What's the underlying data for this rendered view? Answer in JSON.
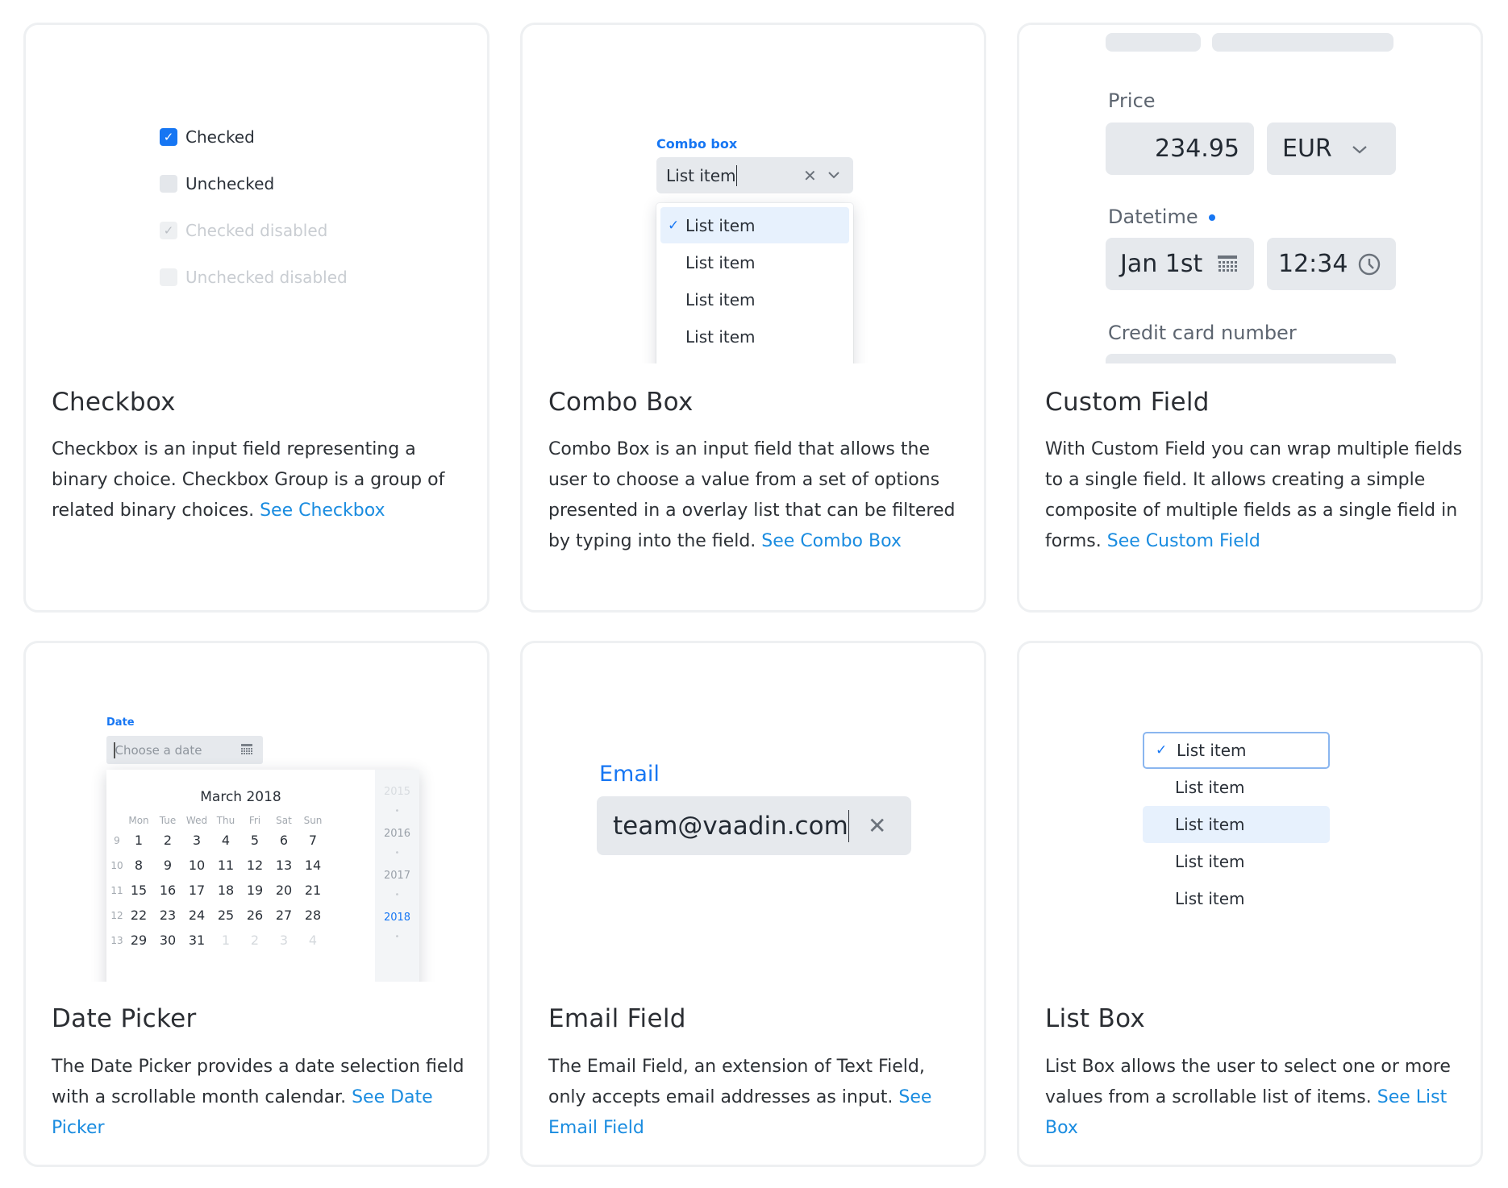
{
  "colors": {
    "accent": "#1676f3",
    "link": "#1a8ce0",
    "field_bg": "#e6e9ed",
    "selected_bg": "#e7f1fd"
  },
  "cards": {
    "checkbox": {
      "title": "Checkbox",
      "description": "Checkbox is an input field representing a binary choice. Checkbox Group is a group of related binary choices. ",
      "link": "See Checkbox",
      "preview": {
        "items": [
          {
            "label": "Checked",
            "checked": true,
            "disabled": false
          },
          {
            "label": "Unchecked",
            "checked": false,
            "disabled": false
          },
          {
            "label": "Checked disabled",
            "checked": true,
            "disabled": true
          },
          {
            "label": "Unchecked disabled",
            "checked": false,
            "disabled": true
          }
        ]
      }
    },
    "combo_box": {
      "title": "Combo Box",
      "description": "Combo Box is an input field that allows the user to choose a value from a set of options presented in a overlay list that can be filtered by typing into the field. ",
      "link": "See Combo Box",
      "preview": {
        "label": "Combo box",
        "value": "List item",
        "clear_icon": "close-icon",
        "toggle_icon": "chevron-down-icon",
        "items": [
          "List item",
          "List item",
          "List item",
          "List item"
        ],
        "selected_index": 0
      }
    },
    "custom_field": {
      "title": "Custom Field",
      "description": "With Custom Field you can wrap multiple fields to a single field. It allows creating a simple composite of multiple fields as a single field in forms. ",
      "link": "See Custom Field",
      "preview": {
        "price_label": "Price",
        "price_value": "234.95",
        "currency_value": "EUR",
        "datetime_label": "Datetime",
        "date_value": "Jan 1st",
        "time_value": "12:34",
        "credit_card_label": "Credit card number"
      }
    },
    "date_picker": {
      "title": "Date Picker",
      "description": "The Date Picker provides a date selection field with a scrollable month calendar. ",
      "link": "See Date Picker",
      "preview": {
        "label": "Date",
        "placeholder": "Choose a date",
        "month_title": "March 2018",
        "weekdays": [
          "Mon",
          "Tue",
          "Wed",
          "Thu",
          "Fri",
          "Sat",
          "Sun"
        ],
        "weeks": [
          {
            "number": "9",
            "days": [
              "1",
              "2",
              "3",
              "4",
              "5",
              "6",
              "7"
            ]
          },
          {
            "number": "10",
            "days": [
              "8",
              "9",
              "10",
              "11",
              "12",
              "13",
              "14"
            ]
          },
          {
            "number": "11",
            "days": [
              "15",
              "16",
              "17",
              "18",
              "19",
              "20",
              "21"
            ]
          },
          {
            "number": "12",
            "days": [
              "22",
              "23",
              "24",
              "25",
              "26",
              "27",
              "28"
            ]
          },
          {
            "number": "13",
            "days": [
              "29",
              "30",
              "31",
              "1",
              "2",
              "3",
              "4"
            ]
          }
        ],
        "years": [
          "2015",
          "2016",
          "2017",
          "2018"
        ],
        "selected_year": "2018"
      }
    },
    "email_field": {
      "title": "Email Field",
      "description": "The Email Field, an extension of Text Field, only accepts email addresses as input. ",
      "link": "See Email Field",
      "preview": {
        "label": "Email",
        "value": "team@vaadin.com"
      }
    },
    "list_box": {
      "title": "List Box",
      "description": "List Box allows the user to select one or more values from a scrollable list of items. ",
      "link": "See List Box",
      "preview": {
        "items": [
          "List item",
          "List item",
          "List item",
          "List item",
          "List item"
        ],
        "selected_index": 0,
        "hovered_index": 2
      }
    }
  }
}
